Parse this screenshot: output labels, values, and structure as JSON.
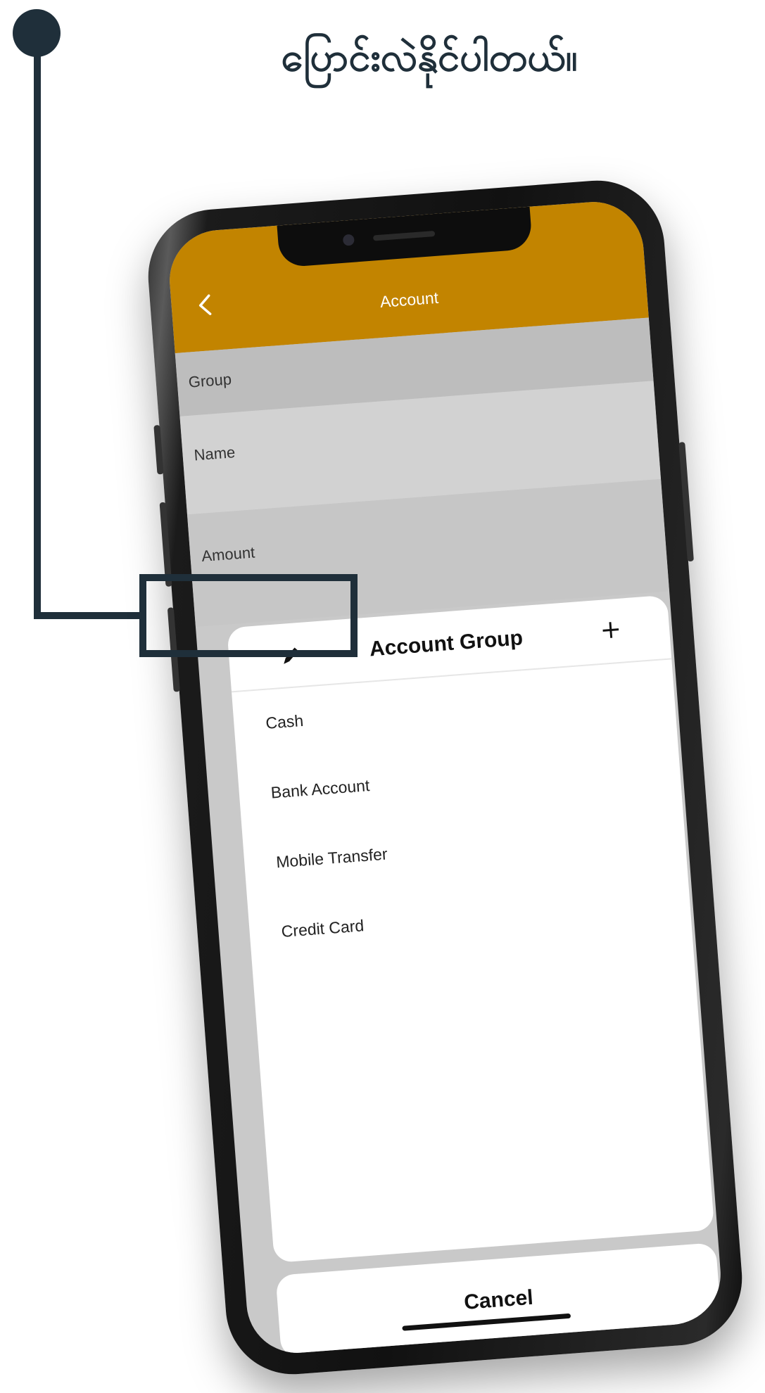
{
  "caption": {
    "text": "ပြောင်းလဲနိုင်ပါတယ်။"
  },
  "app": {
    "header_title": "Account",
    "form": {
      "group_label": "Group",
      "name_label": "Name",
      "amount_label": "Amount"
    },
    "sheet": {
      "title": "Account Group",
      "add_symbol": "+",
      "items": [
        {
          "label": "Cash"
        },
        {
          "label": "Bank Account"
        },
        {
          "label": "Mobile Transfer"
        },
        {
          "label": "Credit Card"
        }
      ],
      "cancel_label": "Cancel"
    }
  },
  "colors": {
    "header": "#c28400",
    "callout": "#1f2f3a",
    "overlay_gray": "#c9c9c9",
    "sheet": "#ffffff"
  },
  "icons": {
    "back": "chevron-left-icon",
    "edit": "pencil-icon",
    "add": "plus-icon"
  }
}
